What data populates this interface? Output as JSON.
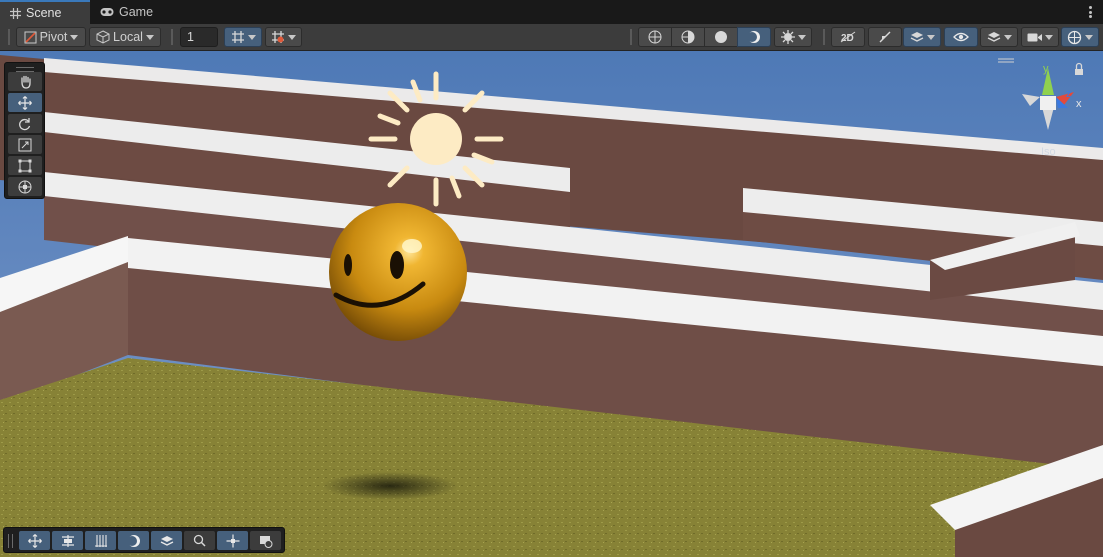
{
  "tabs": [
    {
      "label": "Scene",
      "icon": "grid-icon",
      "active": true
    },
    {
      "label": "Game",
      "icon": "gamepad-icon",
      "active": false
    }
  ],
  "toolbar": {
    "pivot_label": "Pivot",
    "local_label": "Local",
    "grid_size_value": "1",
    "right_icons": [
      "wireframe-sphere-icon",
      "shaded-wireframe-icon",
      "shaded-icon",
      "lighting-icon",
      "effects-icon",
      "2d-icon",
      "audio-mute-icon",
      "gizmo-layers-icon",
      "visibility-icon",
      "layers-icon",
      "camera-icon",
      "gizmos-icon"
    ]
  },
  "tools_vertical": [
    "hand-tool-icon",
    "move-tool-icon",
    "rotate-tool-icon",
    "scale-tool-icon",
    "rect-tool-icon",
    "transform-tool-icon"
  ],
  "tools_horizontal": [
    "move-icon",
    "align-icon",
    "grid-snap-icon",
    "lighting-icon",
    "layers-icon",
    "search-icon",
    "pivot-move-icon",
    "camera-preview-icon"
  ],
  "gizmo": {
    "x_label": "x",
    "y_label": "y",
    "z_label": "z",
    "projection_label": "Iso"
  },
  "colors": {
    "accent": "#3a79bb",
    "sky": "#5b82bd",
    "ground": "#8a8637",
    "wall": "#6d4b43",
    "ball": "#d89c1a",
    "sun": "#fdebc4"
  }
}
